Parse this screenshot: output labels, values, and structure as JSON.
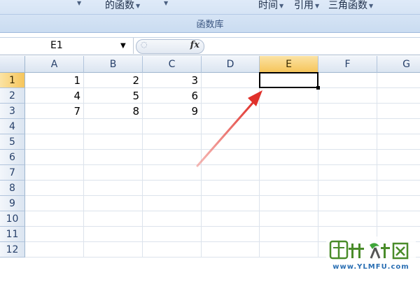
{
  "ribbon": {
    "items": [
      "的函数",
      "时间",
      "引用",
      "三角函数"
    ],
    "group_label": "函数库"
  },
  "formula_bar": {
    "namebox_value": "E1",
    "fx_label": "fx",
    "formula_value": ""
  },
  "columns": [
    "A",
    "B",
    "C",
    "D",
    "E",
    "F",
    "G"
  ],
  "rows": [
    "1",
    "2",
    "3",
    "4",
    "5",
    "6",
    "7",
    "8",
    "9",
    "10",
    "11",
    "12"
  ],
  "cells": [
    [
      "1",
      "2",
      "3"
    ],
    [
      "4",
      "5",
      "6"
    ],
    [
      "7",
      "8",
      "9"
    ]
  ],
  "active_cell": "E1",
  "colors": {
    "selection_header": "#f6c55b",
    "arrow": "#e0302a",
    "ribbon": "#cadcf1"
  },
  "watermark": {
    "logo_text": "雨林木风",
    "url": "www.YLMFU.com"
  }
}
